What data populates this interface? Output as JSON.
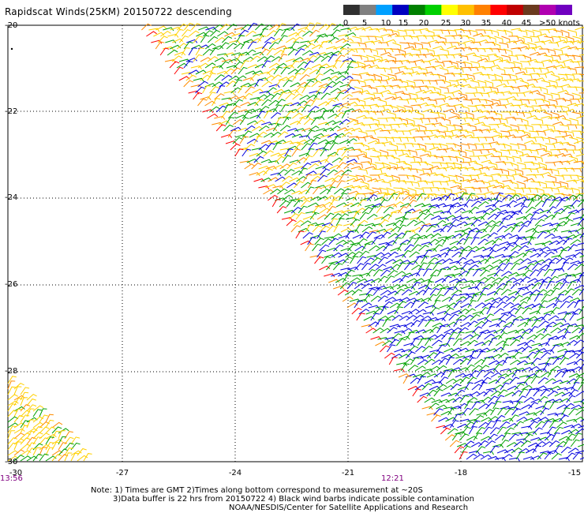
{
  "title": "Rapidscat Winds(25KM) 20150722 descending",
  "lat_labels": [
    "-20",
    "-22",
    "-24",
    "-26",
    "-28",
    "-30"
  ],
  "lon_labels": [
    "-27",
    "-24",
    "-21",
    "-18",
    "-15"
  ],
  "lon_label_left": "-30",
  "times": [
    "13:56",
    "12:21"
  ],
  "legend": {
    "labels": [
      "0",
      "5",
      "10",
      "15",
      "20",
      "25",
      "30",
      "35",
      "40",
      "45",
      ">50 knots"
    ],
    "colors": [
      "#303030",
      "#808080",
      "#00a0ff",
      "#0000c0",
      "#008000",
      "#00d000",
      "#ffff00",
      "#ffc000",
      "#ff8000",
      "#ff0000",
      "#c00000",
      "#6b3a1e",
      "#b000b0",
      "#7000c0"
    ]
  },
  "barb_colors": {
    "blue": "#0000dd",
    "green": "#00a000",
    "yellow": "#ffd000",
    "orange": "#ff8c00",
    "red": "#ff0000"
  },
  "notes": [
    "Note: 1) Times are GMT 2)Times along bottom correspond to measurement at ~20S",
    "3)Data buffer is 22 hrs from 20150722 4) Black wind barbs indicate possible contamination",
    "NOAA/NESDIS/Center for Satellite Applications and Research"
  ]
}
